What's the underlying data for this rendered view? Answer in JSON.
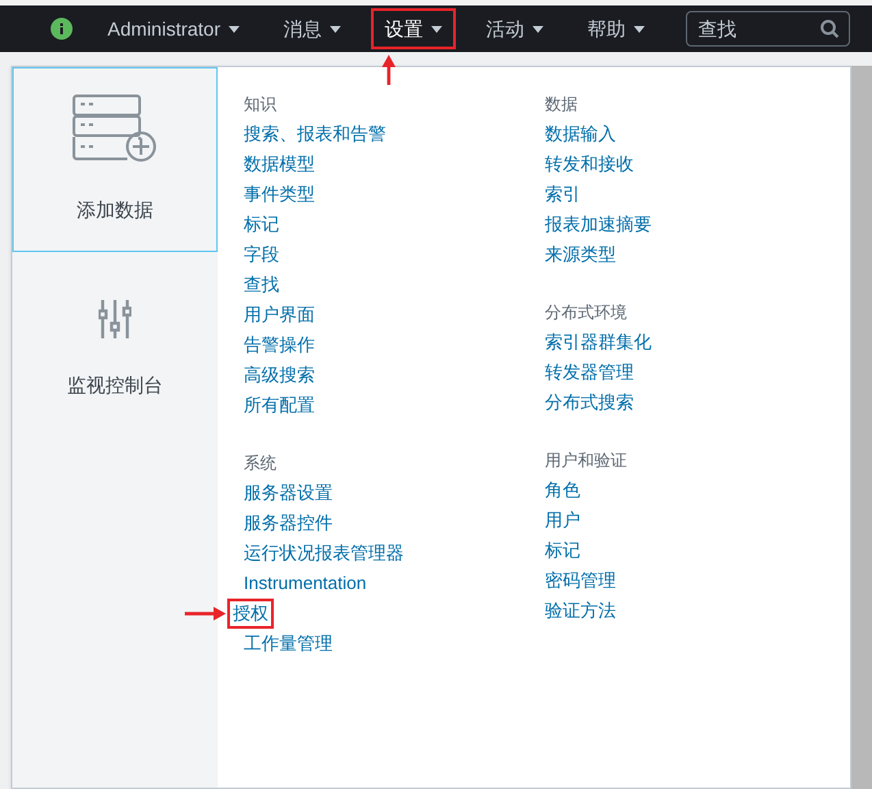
{
  "top_nav": {
    "menus": [
      {
        "label": "Administrator",
        "selected": false,
        "highlighted": false
      },
      {
        "label": "消息",
        "selected": false,
        "highlighted": false
      },
      {
        "label": "设置",
        "selected": true,
        "highlighted": true
      },
      {
        "label": "活动",
        "selected": false,
        "highlighted": false
      },
      {
        "label": "帮助",
        "selected": false,
        "highlighted": false
      }
    ],
    "search": {
      "placeholder": "查找"
    }
  },
  "settings_menu": {
    "tiles": [
      {
        "kind": "add-data",
        "label": "添加数据",
        "selected": true
      },
      {
        "kind": "monitor",
        "label": "监视控制台",
        "selected": false
      }
    ],
    "columns": [
      [
        {
          "heading": "知识",
          "items": [
            {
              "label": "搜索、报表和告警",
              "highlighted": false
            },
            {
              "label": "数据模型",
              "highlighted": false
            },
            {
              "label": "事件类型",
              "highlighted": false
            },
            {
              "label": "标记",
              "highlighted": false
            },
            {
              "label": "字段",
              "highlighted": false
            },
            {
              "label": "查找",
              "highlighted": false
            },
            {
              "label": "用户界面",
              "highlighted": false
            },
            {
              "label": "告警操作",
              "highlighted": false
            },
            {
              "label": "高级搜索",
              "highlighted": false
            },
            {
              "label": "所有配置",
              "highlighted": false
            }
          ]
        },
        {
          "heading": "系统",
          "items": [
            {
              "label": "服务器设置",
              "highlighted": false
            },
            {
              "label": "服务器控件",
              "highlighted": false
            },
            {
              "label": "运行状况报表管理器",
              "highlighted": false
            },
            {
              "label": "Instrumentation",
              "highlighted": false
            },
            {
              "label": "授权",
              "highlighted": true
            },
            {
              "label": "工作量管理",
              "highlighted": false
            }
          ]
        }
      ],
      [
        {
          "heading": "数据",
          "items": [
            {
              "label": "数据输入",
              "highlighted": false
            },
            {
              "label": "转发和接收",
              "highlighted": false
            },
            {
              "label": "索引",
              "highlighted": false
            },
            {
              "label": "报表加速摘要",
              "highlighted": false
            },
            {
              "label": "来源类型",
              "highlighted": false
            }
          ]
        },
        {
          "heading": "分布式环境",
          "items": [
            {
              "label": "索引器群集化",
              "highlighted": false
            },
            {
              "label": "转发器管理",
              "highlighted": false
            },
            {
              "label": "分布式搜索",
              "highlighted": false
            }
          ]
        },
        {
          "heading": "用户和验证",
          "items": [
            {
              "label": "角色",
              "highlighted": false
            },
            {
              "label": "用户",
              "highlighted": false
            },
            {
              "label": "标记",
              "highlighted": false
            },
            {
              "label": "密码管理",
              "highlighted": false
            },
            {
              "label": "验证方法",
              "highlighted": false
            }
          ]
        }
      ]
    ]
  }
}
